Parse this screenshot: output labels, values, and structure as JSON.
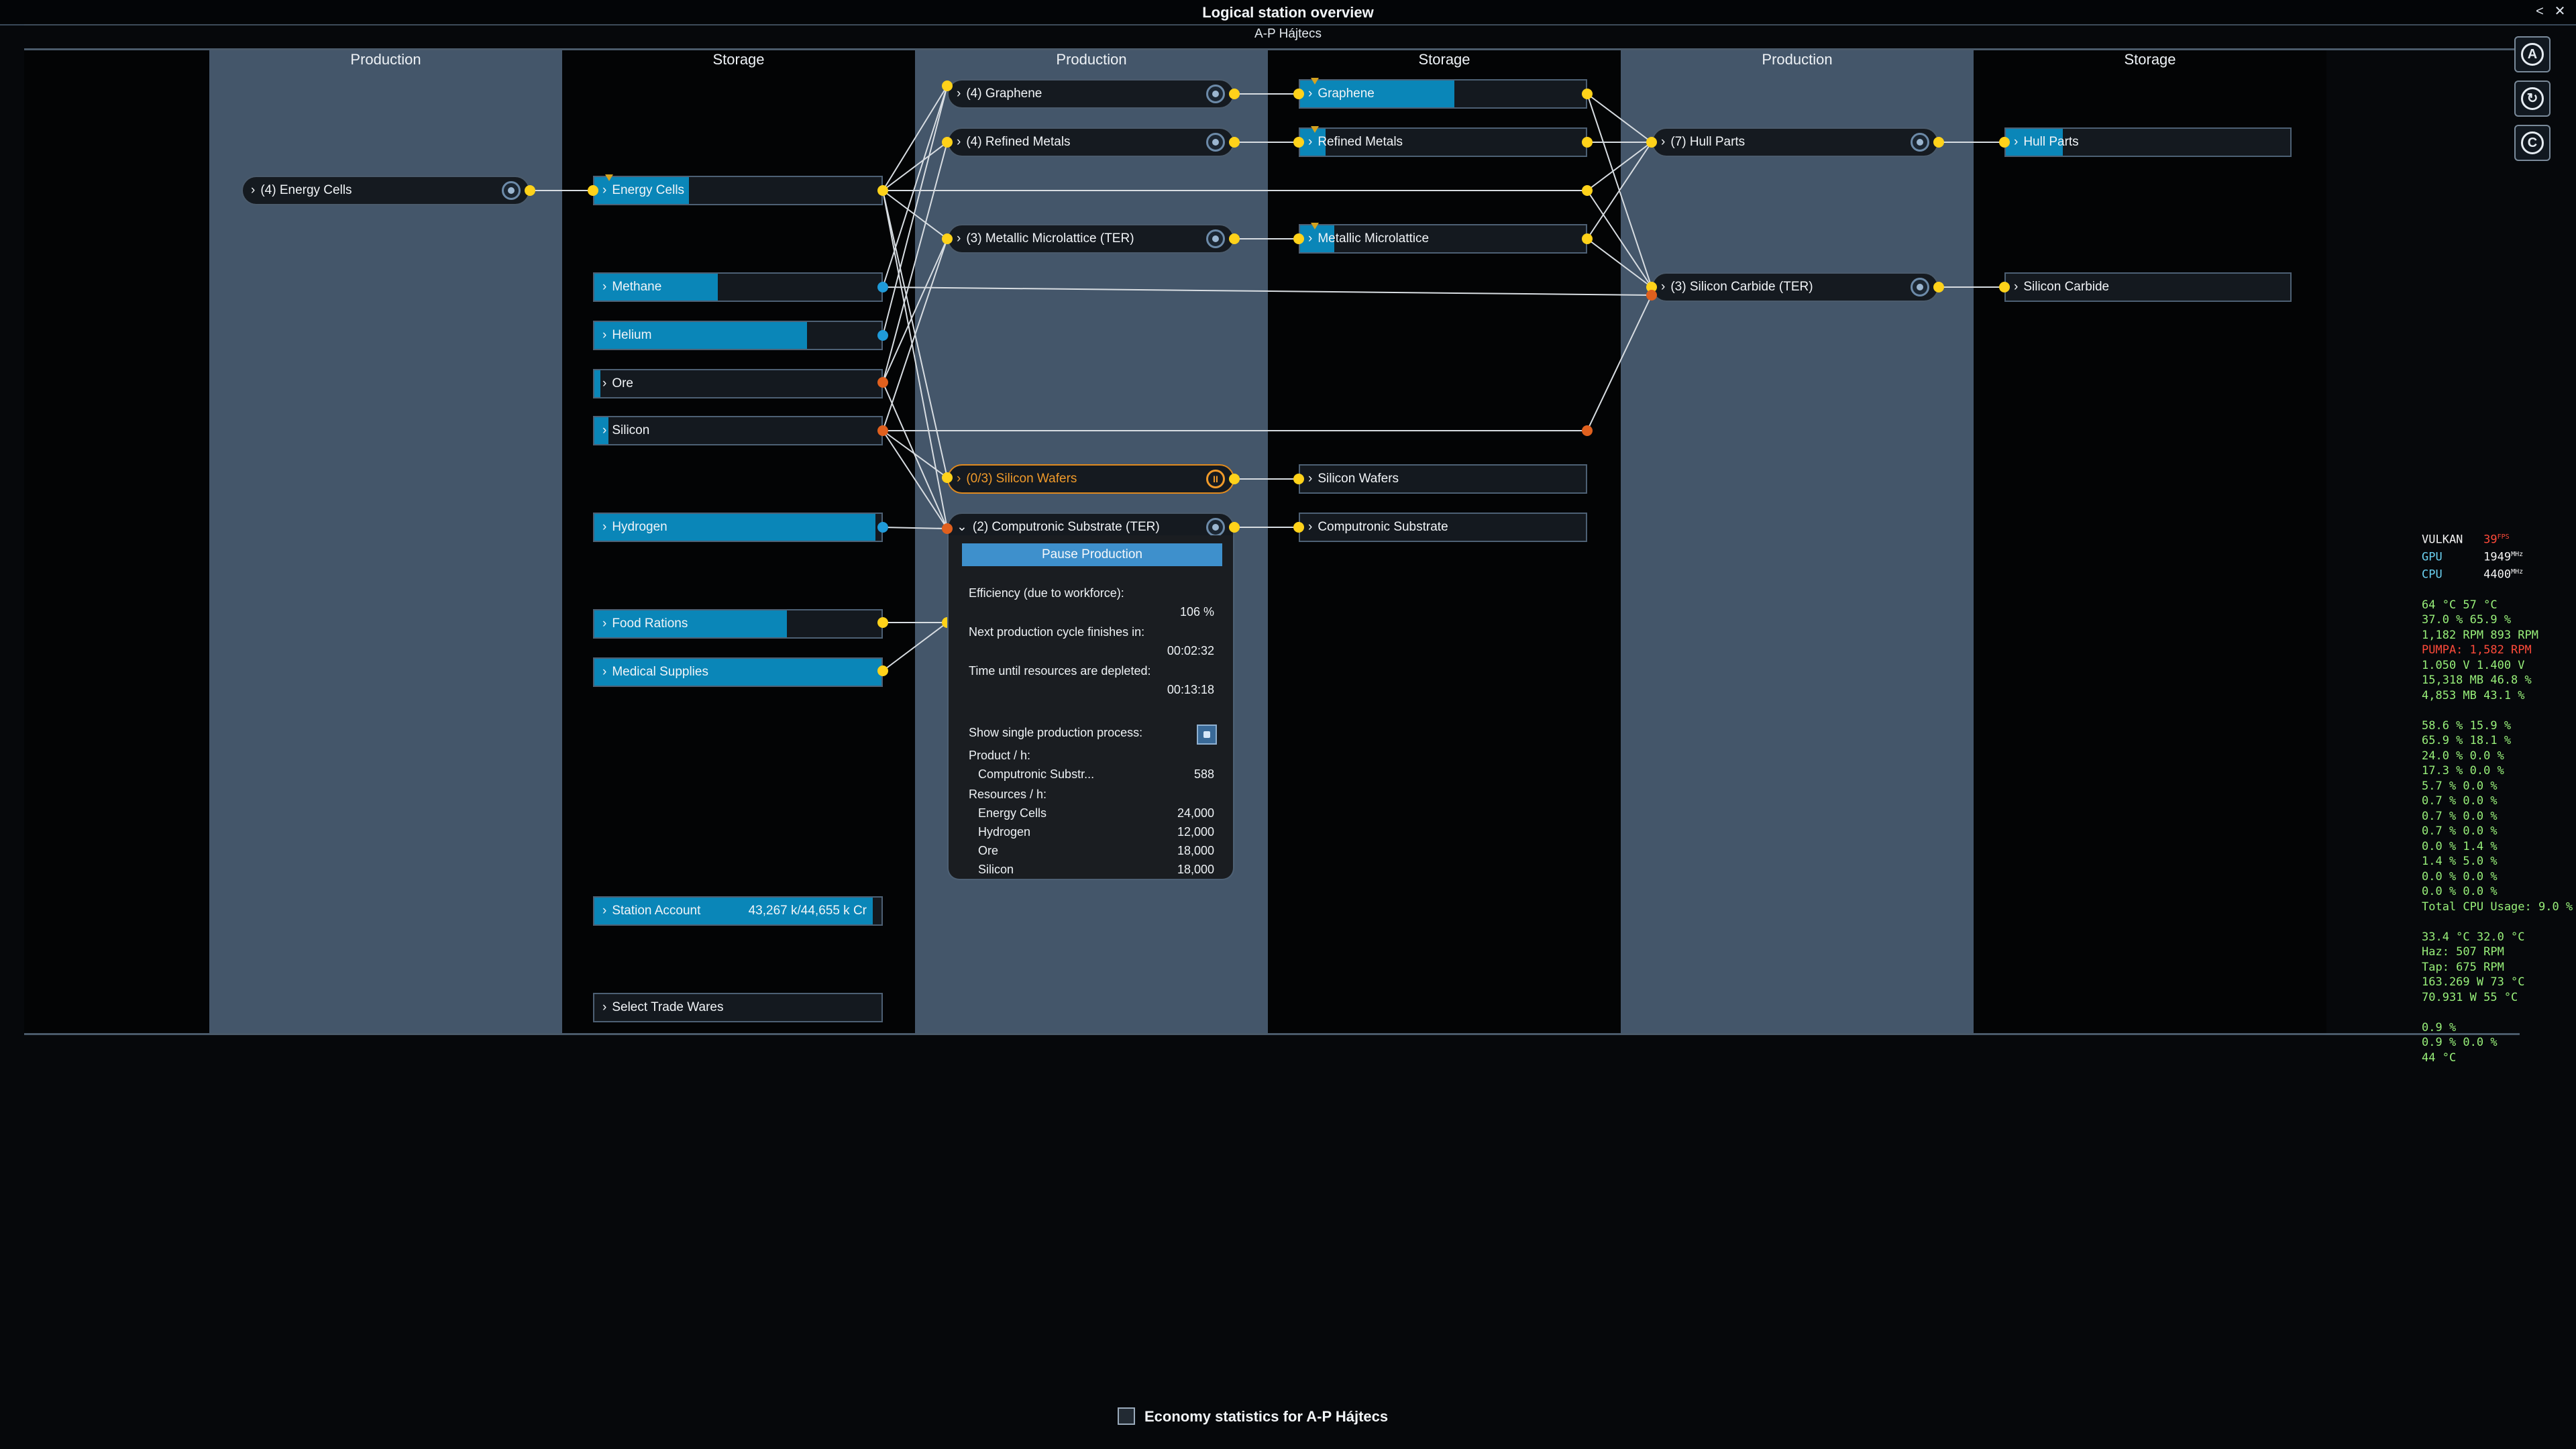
{
  "window": {
    "title": "Logical station overview",
    "station": "A-P Hájtecs",
    "btn_back": "<",
    "btn_close": "✕"
  },
  "columns": [
    "Production",
    "Storage",
    "Production",
    "Storage",
    "Production",
    "Storage"
  ],
  "productions": [
    {
      "label": "(4) Energy Cells",
      "active": false
    },
    {
      "label": "(4) Graphene",
      "active": false
    },
    {
      "label": "(4) Refined Metals",
      "active": false
    },
    {
      "label": "(3) Metallic Microlattice (TER)",
      "active": false
    },
    {
      "label": "(0/3) Silicon Wafers",
      "active": true
    },
    {
      "label": "(2) Computronic Substrate (TER)",
      "active": false,
      "expanded": true
    },
    {
      "label": "(7) Hull Parts",
      "active": false
    },
    {
      "label": "(3) Silicon Carbide (TER)",
      "active": false
    }
  ],
  "storage": [
    {
      "label": "Energy Cells",
      "fill": 0.33
    },
    {
      "label": "Methane",
      "fill": 0.43
    },
    {
      "label": "Helium",
      "fill": 0.74
    },
    {
      "label": "Ore",
      "fill": 0.02
    },
    {
      "label": "Silicon",
      "fill": 0.05
    },
    {
      "label": "Hydrogen",
      "fill": 0.98
    },
    {
      "label": "Food Rations",
      "fill": 0.67
    },
    {
      "label": "Medical Supplies",
      "fill": 1.0
    },
    {
      "label": "Graphene",
      "fill": 0.54
    },
    {
      "label": "Refined Metals",
      "fill": 0.09
    },
    {
      "label": "Metallic Microlattice",
      "fill": 0.12
    },
    {
      "label": "Silicon Wafers",
      "fill": 0.0
    },
    {
      "label": "Computronic Substrate",
      "fill": 0.0
    },
    {
      "label": "Hull Parts",
      "fill": 0.2
    },
    {
      "label": "Silicon Carbide",
      "fill": 0.0
    }
  ],
  "station_account": {
    "label": "Station Account",
    "value": "43,267 k/44,655 k Cr",
    "fill": 0.97
  },
  "select_trade_wares": "Select Trade Wares",
  "popup": {
    "pause_label": "Pause Production",
    "efficiency_label": "Efficiency (due to workforce):",
    "efficiency_value": "106 %",
    "next_cycle_label": "Next production cycle finishes in:",
    "next_cycle_value": "00:02:32",
    "depleted_label": "Time until resources are depleted:",
    "depleted_value": "00:13:18",
    "single_process_label": "Show single production process:",
    "product_header": "Product / h:",
    "product": {
      "name": "Computronic Substr...",
      "value": "588"
    },
    "resources_header": "Resources / h:",
    "resources": [
      {
        "name": "Energy Cells",
        "value": "24,000"
      },
      {
        "name": "Hydrogen",
        "value": "12,000"
      },
      {
        "name": "Ore",
        "value": "18,000"
      },
      {
        "name": "Silicon",
        "value": "18,000"
      }
    ]
  },
  "side_icons": [
    "A",
    "↻",
    "C"
  ],
  "perf_overlay": {
    "vulkan_label": "VULKAN",
    "vulkan_fps": "39",
    "fps_unit": "FPS",
    "gpu_label": "GPU",
    "gpu_mhz": "1949",
    "cpu_label": "CPU",
    "cpu_mhz": "4400",
    "mhz_unit": "MHz",
    "lines_a": [
      "64 °C 57 °C",
      "37.0 % 65.9 %",
      "1,182 RPM 893 RPM"
    ],
    "pumpa": "PUMPA: 1,582 RPM",
    "lines_b": [
      "1.050 V 1.400 V",
      "15,318 MB 46.8 %",
      "4,853 MB 43.1 %"
    ],
    "lines_c": [
      "58.6 % 15.9 %",
      "65.9 % 18.1 %",
      "24.0 % 0.0 %",
      "17.3 % 0.0 %",
      "5.7 % 0.0 %",
      "0.7 % 0.0 %",
      "0.7 % 0.0 %",
      "0.7 % 0.0 %",
      "0.0 % 1.4 %",
      "1.4 % 5.0 %",
      "0.0 % 0.0 %",
      "0.0 % 0.0 %",
      "Total CPU Usage: 9.0 %"
    ],
    "lines_d": [
      "33.4 °C 32.0 °C",
      "Haz: 507 RPM",
      "Tap: 675 RPM",
      "163.269 W 73 °C",
      "70.931 W 55 °C"
    ],
    "lines_e": [
      "0.9 %",
      "0.9 % 0.0 %",
      "44 °C"
    ]
  },
  "economy": {
    "label": "Economy statistics for A-P Hájtecs"
  },
  "colors": {
    "accent": "#0a86b8",
    "panel": "#44566a",
    "connector_yellow": "#ffd21a",
    "connector_blue": "#1f9ad8",
    "connector_orange": "#e0601e",
    "active_orange": "#f09a2a"
  }
}
